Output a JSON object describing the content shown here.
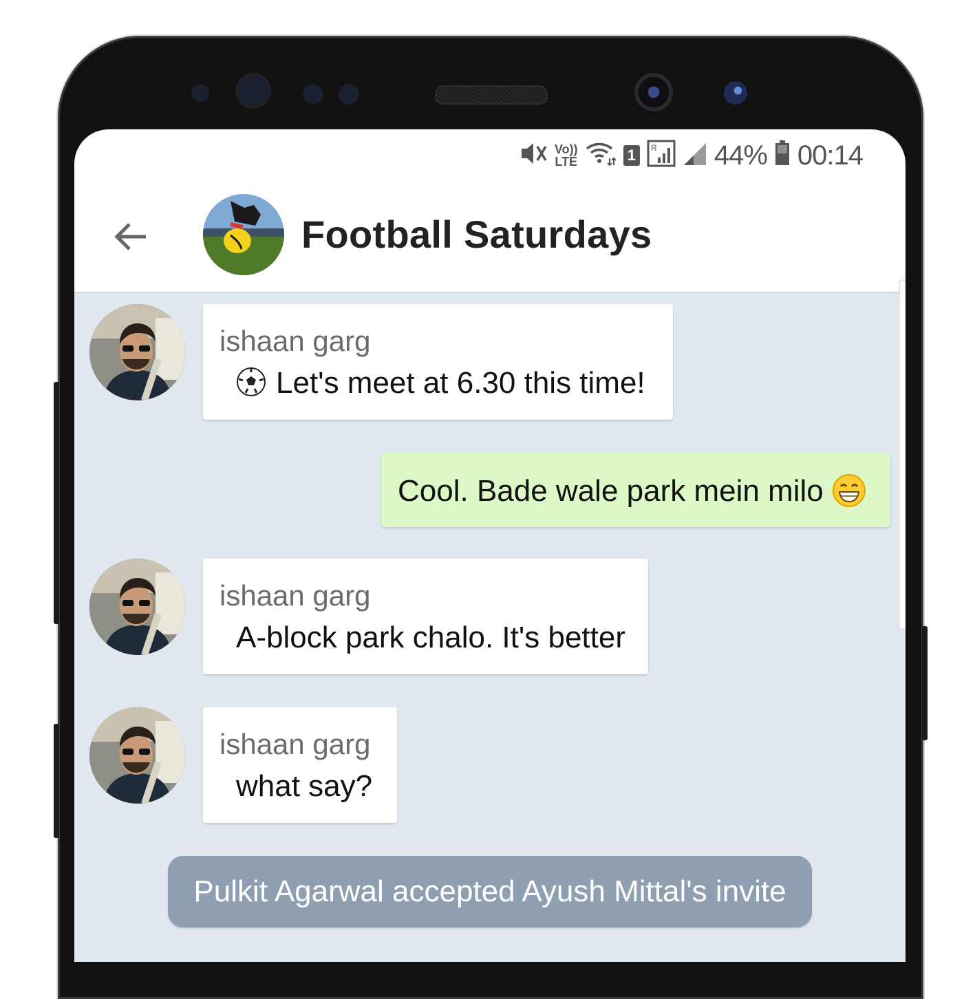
{
  "status_bar": {
    "icons": [
      "mute-vibrate-icon",
      "volte-icon",
      "wifi-icon",
      "sim-1-icon",
      "roaming-signal-icon",
      "signal-icon",
      "battery-icon"
    ],
    "volte_top": "Vo))",
    "volte_bottom": "LTE",
    "sim_label": "1",
    "battery_percent": "44%",
    "time": "00:14"
  },
  "header": {
    "title": "Football Saturdays"
  },
  "messages": [
    {
      "sender": "ishaan garg",
      "text": "Let's meet at 6.30 this time!",
      "emoji": "soccer-ball-icon",
      "direction": "incoming"
    },
    {
      "text": "Cool. Bade wale park mein milo",
      "emoji": "grinning-face-icon",
      "direction": "outgoing"
    },
    {
      "sender": "ishaan garg",
      "text": "A-block park chalo. It's better",
      "direction": "incoming"
    },
    {
      "sender": "ishaan garg",
      "text": "what say?",
      "direction": "incoming"
    }
  ],
  "system_message": "Pulkit Agarwal accepted Ayush Mittal's invite",
  "colors": {
    "chat_background": "#e1e8ef",
    "incoming_bubble": "#ffffff",
    "outgoing_bubble": "#dcf8c6",
    "system_bubble": "#8f9fb1"
  }
}
